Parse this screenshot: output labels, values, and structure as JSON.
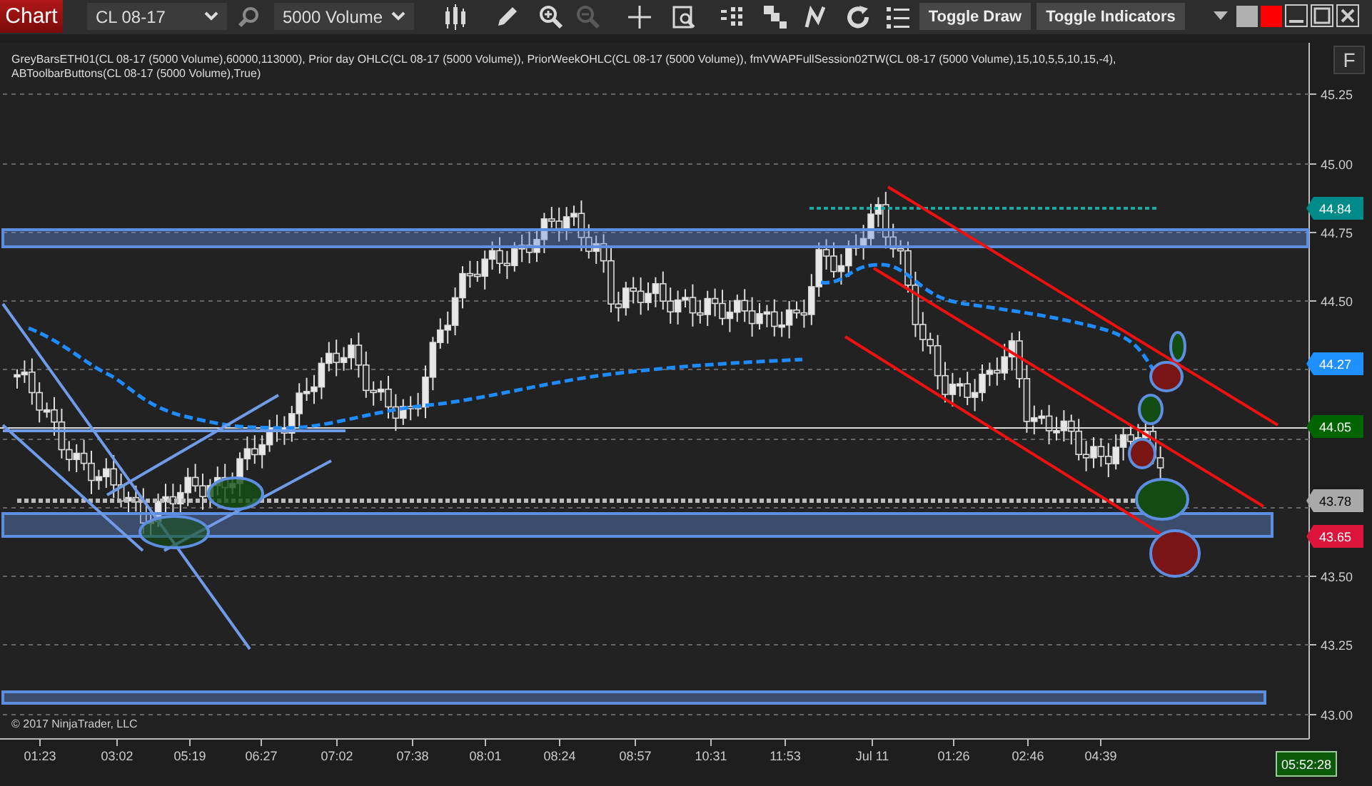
{
  "toolbar": {
    "chart_button": "Chart",
    "instrument": "CL 08-17",
    "interval": "5000 Volume",
    "tools": [
      {
        "kind": "bars",
        "disabled": false
      },
      {
        "kind": "pencil",
        "disabled": false
      },
      {
        "kind": "zoom-in",
        "disabled": false
      },
      {
        "kind": "zoom-out",
        "disabled": true
      },
      {
        "kind": "crosshair",
        "disabled": false
      },
      {
        "kind": "properties",
        "disabled": false
      },
      {
        "kind": "columns",
        "disabled": false
      },
      {
        "kind": "layers",
        "disabled": false
      },
      {
        "kind": "line",
        "disabled": false
      },
      {
        "kind": "refresh",
        "disabled": false
      },
      {
        "kind": "list",
        "disabled": false
      }
    ],
    "buttons": [
      "Toggle Draw",
      "Toggle Indicators"
    ],
    "swatches": [
      {
        "color": "#b0b0b0"
      },
      {
        "color": "#ff0000"
      }
    ]
  },
  "indicator_legend": [
    "GreyBarsETH01(CL 08-17 (5000 Volume),60000,113000), Prior day OHLC(CL 08-17 (5000 Volume)), PriorWeekOHLC(CL 08-17 (5000 Volume)), fmVWAPFullSession02TW(CL 08-17 (5000 Volume),15,10,5,5,10,15,-4),",
    "ABToolbarButtons(CL 08-17 (5000 Volume),True)"
  ],
  "panel_button": "F",
  "price_axis": {
    "ticks": [
      "45.25",
      "45.00",
      "44.75",
      "44.50",
      "43.50",
      "43.25",
      "43.00"
    ]
  },
  "price_markers": [
    {
      "label": "44.84",
      "color": "#008b8b"
    },
    {
      "label": "44.27",
      "color": "#1e90ff"
    },
    {
      "label": "44.05",
      "color": "#006400"
    },
    {
      "label": "43.78",
      "color": "#a9a9a9"
    },
    {
      "label": "43.65",
      "color": "#dc143c"
    }
  ],
  "time_axis": {
    "ticks": [
      "01:23",
      "03:02",
      "05:19",
      "06:27",
      "07:02",
      "07:38",
      "08:01",
      "08:24",
      "08:57",
      "10:31",
      "11:53",
      "Jul 11",
      "01:26",
      "02:46",
      "04:39"
    ]
  },
  "copyright": "© 2017 NinjaTrader, LLC",
  "clock": "05:52:28"
}
